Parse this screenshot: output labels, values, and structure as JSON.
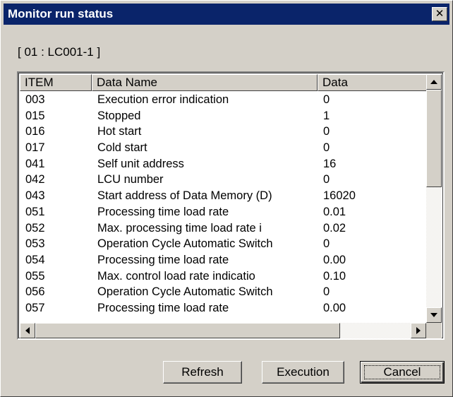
{
  "window": {
    "title": "Monitor run status",
    "close_glyph": "✕"
  },
  "unit_label": "[ 01 : LC001-1 ]",
  "table": {
    "columns": [
      "ITEM",
      "Data Name",
      "Data"
    ],
    "rows": [
      {
        "item": "003",
        "name": "Execution error indication",
        "data": "0"
      },
      {
        "item": "015",
        "name": "Stopped",
        "data": "1"
      },
      {
        "item": "016",
        "name": "Hot start",
        "data": "0"
      },
      {
        "item": "017",
        "name": "Cold start",
        "data": "0"
      },
      {
        "item": "041",
        "name": "Self unit address",
        "data": "16"
      },
      {
        "item": "042",
        "name": "LCU number",
        "data": "0"
      },
      {
        "item": "043",
        "name": "Start address of Data Memory (D)",
        "data": "16020"
      },
      {
        "item": "051",
        "name": "Processing time load rate",
        "data": "0.01"
      },
      {
        "item": "052",
        "name": "Max. processing time load rate i",
        "data": "0.02"
      },
      {
        "item": "053",
        "name": "Operation Cycle Automatic Switch",
        "data": "0"
      },
      {
        "item": "054",
        "name": "Processing time load rate",
        "data": "0.00"
      },
      {
        "item": "055",
        "name": "Max. control load rate indicatio",
        "data": "0.10"
      },
      {
        "item": "056",
        "name": "Operation Cycle Automatic Switch",
        "data": "0"
      },
      {
        "item": "057",
        "name": "Processing time load rate",
        "data": "0.00"
      }
    ],
    "vertical_scroll_fraction": 0.0,
    "horizontal_scroll_fraction": 0.0
  },
  "buttons": {
    "refresh": "Refresh",
    "execution": "Execution",
    "cancel": "Cancel"
  },
  "scroll_icons": {
    "up": "up-arrow-icon",
    "down": "down-arrow-icon",
    "left": "left-arrow-icon",
    "right": "right-arrow-icon"
  },
  "colors": {
    "titlebar": "#0a246a",
    "face": "#d4d0c8"
  }
}
